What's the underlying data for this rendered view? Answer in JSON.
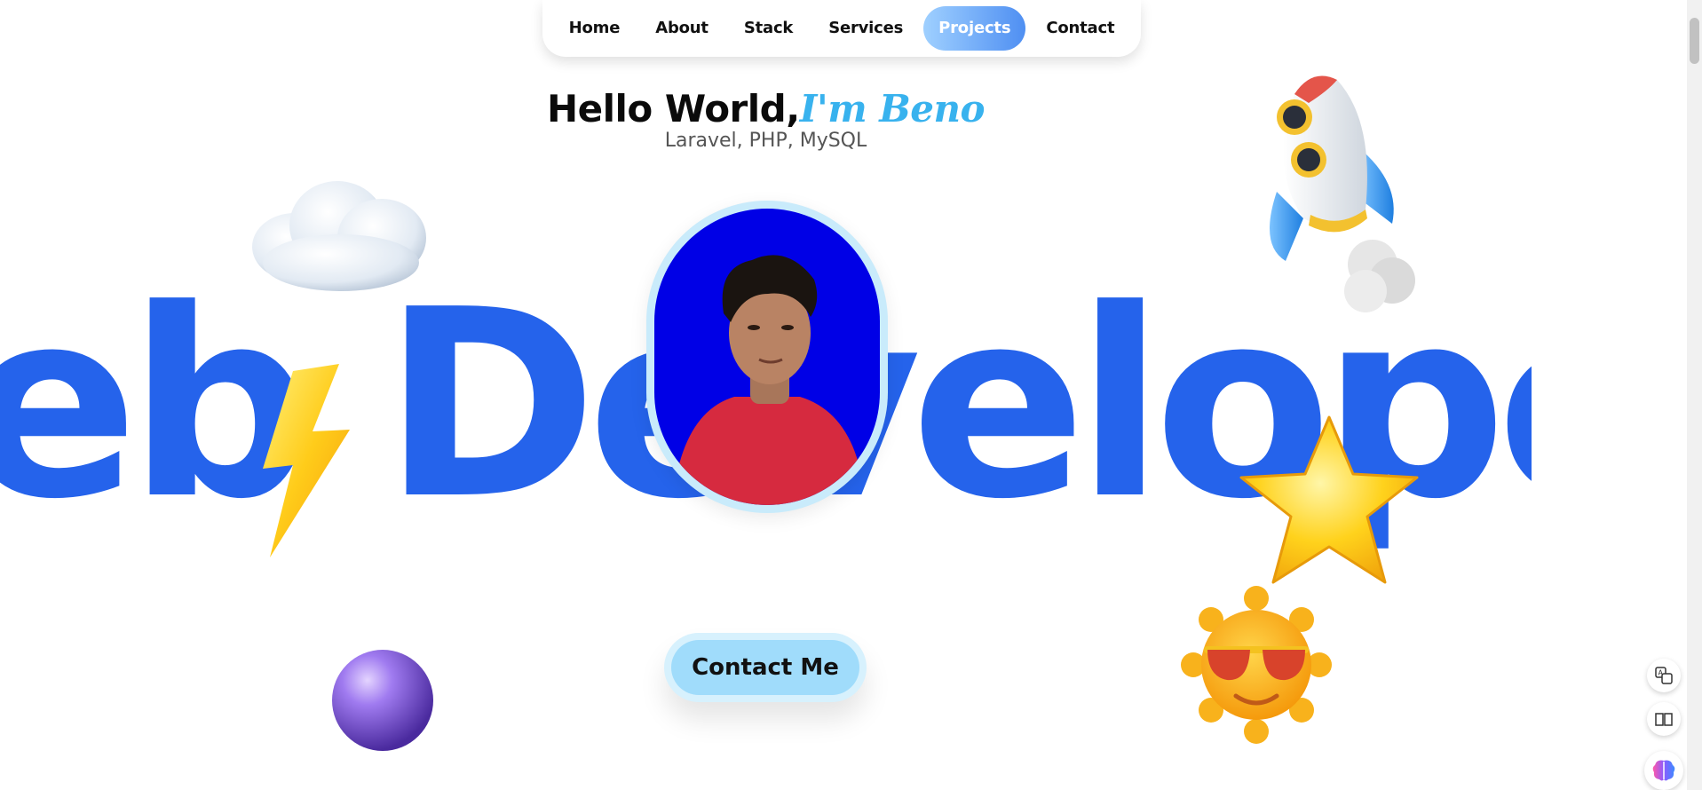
{
  "nav": {
    "items": [
      {
        "label": "Home",
        "active": false
      },
      {
        "label": "About",
        "active": false
      },
      {
        "label": "Stack",
        "active": false
      },
      {
        "label": "Services",
        "active": false
      },
      {
        "label": "Projects",
        "active": true
      },
      {
        "label": "Contact",
        "active": false
      }
    ]
  },
  "hero": {
    "greeting": "Hello World,",
    "name": "I'm Beno",
    "subtitle": "Laravel, PHP, MySQL",
    "marquee_text": "eb Developer",
    "contact_button": "Contact Me",
    "portrait_alt": "Portrait of Beno"
  },
  "decorations": {
    "cloud": "cloud-icon",
    "rocket": "rocket-icon",
    "lightning": "lightning-icon",
    "star": "star-icon",
    "sun": "sun-with-sunglasses-icon",
    "sphere": "purple-sphere-icon"
  },
  "colors": {
    "accent_blue": "#2563eb",
    "name_blue": "#38b2ee",
    "portrait_bg": "#0000e6",
    "button_bg": "#a0dcfb"
  },
  "side_tools": [
    "translate-icon",
    "reader-icon",
    "brain-icon"
  ]
}
